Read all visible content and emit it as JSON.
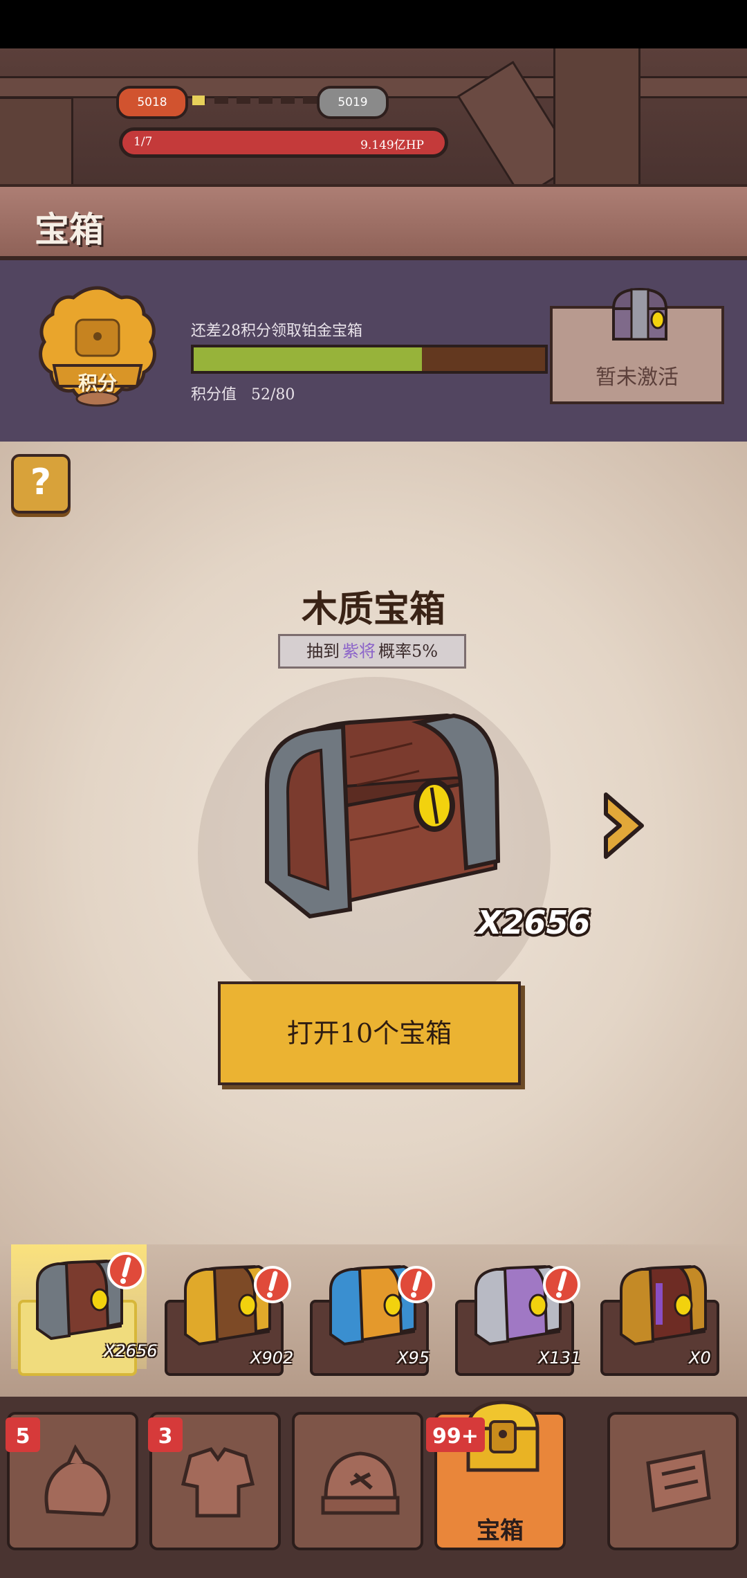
{
  "header": {
    "current_stage": "5018",
    "next_stage": "5019",
    "wave": "1/7",
    "boss_hp": "9.149亿HP"
  },
  "title": "宝箱",
  "points": {
    "badge_label": "积分",
    "hint": "还差28积分领取铂金宝箱",
    "value_label": "积分值",
    "value": "52/80",
    "progress": 0.65,
    "inactive_label": "暂未激活"
  },
  "chest": {
    "name": "木质宝箱",
    "sub_prefix": "抽到",
    "sub_highlight": "紫将",
    "sub_suffix": "概率5%",
    "count": "X2656",
    "open_button": "打开10个宝箱",
    "help": "?"
  },
  "slots": [
    {
      "type": "wood",
      "count": "X2656",
      "selected": true,
      "alert": true
    },
    {
      "type": "gold",
      "count": "X902",
      "selected": false,
      "alert": true
    },
    {
      "type": "blue",
      "count": "X95",
      "selected": false,
      "alert": true
    },
    {
      "type": "purple",
      "count": "X131",
      "selected": false,
      "alert": true
    },
    {
      "type": "dark",
      "count": "X0",
      "selected": false,
      "alert": false
    }
  ],
  "nav": {
    "tabs": [
      {
        "icon": "hero-icon",
        "badge": "5"
      },
      {
        "icon": "armor-icon",
        "badge": "3"
      },
      {
        "icon": "forge-icon",
        "badge": ""
      },
      {
        "icon": "chest-icon",
        "badge": "99+",
        "label": "宝箱",
        "active": true
      },
      {
        "icon": "scroll-icon",
        "badge": ""
      }
    ]
  },
  "colors": {
    "accent": "#ebb332",
    "panel": "#524560",
    "progress_fill": "#97b33a",
    "hp_bar": "#c43a3a",
    "highlight_text": "#8b63c9"
  }
}
